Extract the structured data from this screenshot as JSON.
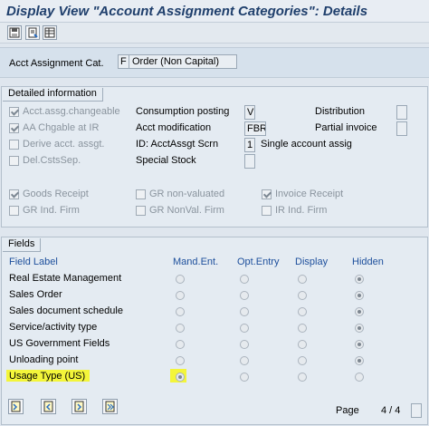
{
  "title": "Display View \"Account Assignment Categories\": Details",
  "toolbar": {
    "buttons": [
      "save-icon",
      "print-icon",
      "table-icon"
    ]
  },
  "header": {
    "label": "Acct Assignment Cat.",
    "key": "F",
    "desc": "Order (Non Capital)"
  },
  "detailed": {
    "title": "Detailed information",
    "checks": [
      {
        "label": "Acct.assg.changeable",
        "checked": true
      },
      {
        "label": "AA Chgable at IR",
        "checked": true
      },
      {
        "label": "Derive acct. assgt.",
        "checked": false
      },
      {
        "label": "Del.CstsSep.",
        "checked": false
      }
    ],
    "mid_labels": [
      "Consumption posting",
      "Acct modification",
      "ID: AcctAssgt Scrn",
      "Special Stock"
    ],
    "mid_values": [
      "V",
      "FBR",
      "1",
      ""
    ],
    "scrn_desc": "Single account assig",
    "right_labels": [
      "Distribution",
      "Partial invoice"
    ],
    "gr_checks": [
      {
        "label": "Goods Receipt",
        "checked": true
      },
      {
        "label": "GR non-valuated",
        "checked": false
      },
      {
        "label": "Invoice Receipt",
        "checked": true
      },
      {
        "label": "GR Ind. Firm",
        "checked": false
      },
      {
        "label": "GR NonVal. Firm",
        "checked": false
      },
      {
        "label": "IR Ind. Firm",
        "checked": false
      }
    ]
  },
  "fields": {
    "title": "Fields",
    "columns": [
      "Field Label",
      "Mand.Ent.",
      "Opt.Entry",
      "Display",
      "Hidden"
    ],
    "rows": [
      {
        "label": "Real Estate Management",
        "selected": 3
      },
      {
        "label": "Sales Order",
        "selected": 3
      },
      {
        "label": "Sales document schedule",
        "selected": 3
      },
      {
        "label": "Service/activity type",
        "selected": 3
      },
      {
        "label": "US Government Fields",
        "selected": 3
      },
      {
        "label": "Unloading point",
        "selected": 3
      },
      {
        "label": "Usage Type (US)",
        "selected": 0
      }
    ],
    "page_label": "Page",
    "page_value": "4 / 4"
  },
  "highlight_color": "#f3f53a",
  "bottom_buttons": [
    "first-page-icon",
    "previous-page-icon",
    "next-page-icon",
    "last-page-icon"
  ]
}
